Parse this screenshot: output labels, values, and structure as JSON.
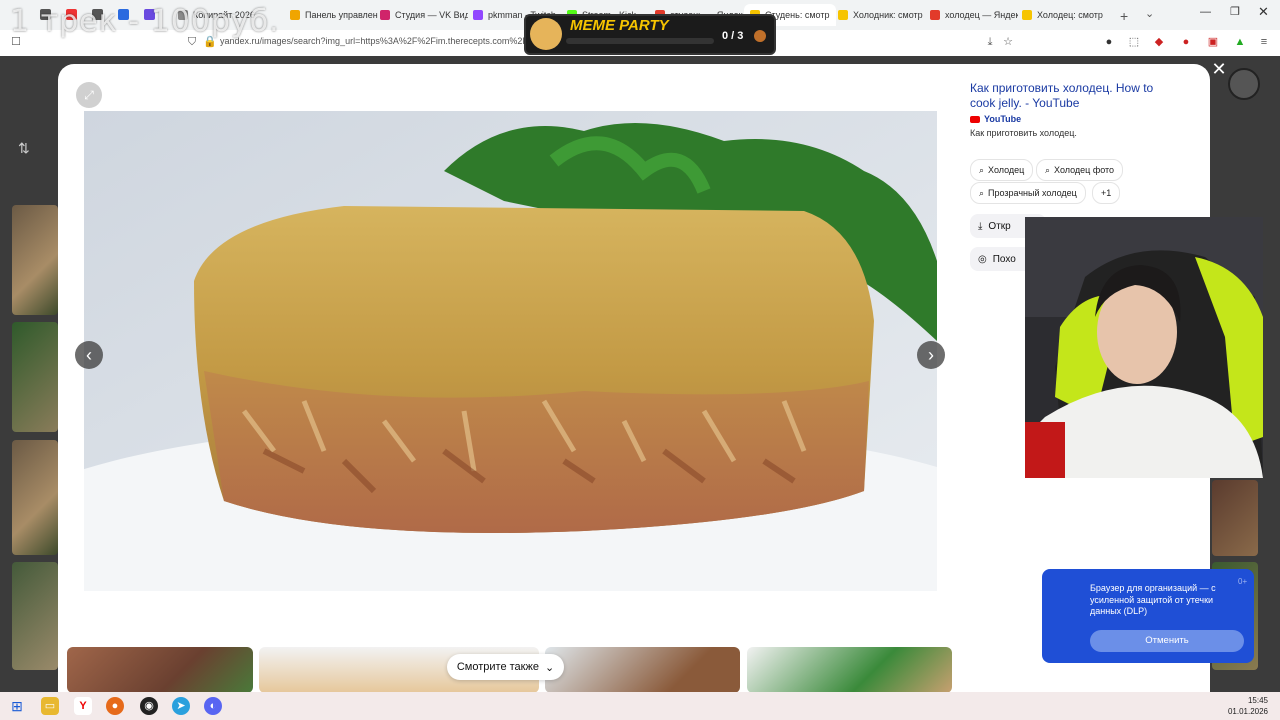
{
  "browser": {
    "tabs": [
      {
        "label": "Копирайт 2026",
        "color": "#8a8a8a"
      },
      {
        "label": "Панель управлен",
        "color": "#f0a500"
      },
      {
        "label": "Студия — VK Вид",
        "color": "#d0246a"
      },
      {
        "label": "pkmman - Twitch",
        "color": "#9146ff"
      },
      {
        "label": "Stream - Kick",
        "color": "#53fc18"
      },
      {
        "label": "студень — Яндек",
        "color": "#e23a2a"
      },
      {
        "label": "Студень: смотр",
        "color": "#f6c400"
      },
      {
        "label": "Холодник: смотр",
        "color": "#f6c400"
      },
      {
        "label": "холодец — Яндек",
        "color": "#e23a2a"
      },
      {
        "label": "Холодец: смотр",
        "color": "#f6c400"
      }
    ],
    "url": "yandex.ru/images/search?img_url=https%3A%2F%2Fim.therecepts.com%2F...4&rpt=simage&source=serp&text=студень"
  },
  "result": {
    "title": "Как приготовить холодец. How to cook jelly. - YouTube",
    "source": "YouTube",
    "description": "Как приготовить холодец.",
    "chips": [
      "Холодец",
      "Холодец фото",
      "Прозрачный холодец",
      "+1"
    ],
    "open_label": "Откр",
    "similar_label": "Похо"
  },
  "see_also": "Смотрите также",
  "dlp": {
    "text": "Браузер для организаций — с усиленной защитой от утечки данных (DLP)",
    "button": "Отменить",
    "badge": "0+"
  },
  "stream": {
    "overlay_text": "1 трек - 100руб.",
    "meme_title": "MEME PARTY",
    "meme_counter": "0 / 3"
  },
  "taskbar": {
    "time": "15:45",
    "date": "01.01.2026"
  }
}
